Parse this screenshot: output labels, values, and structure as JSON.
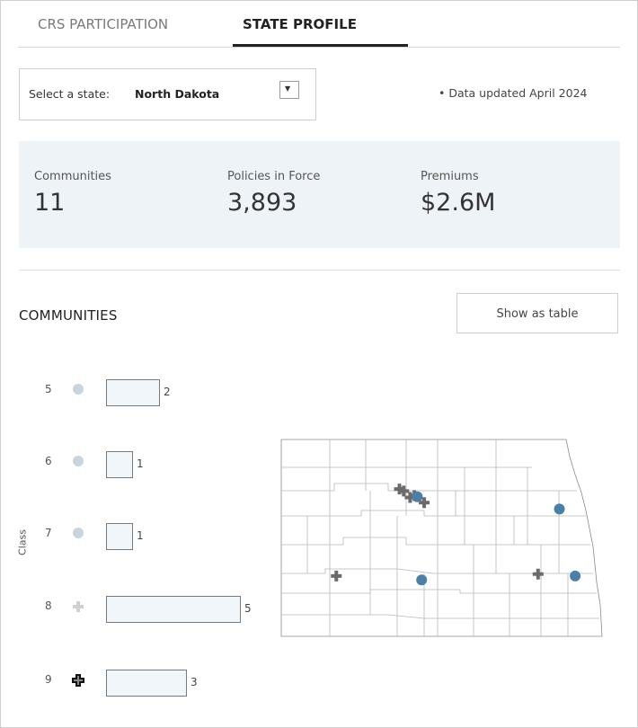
{
  "tabs": [
    {
      "label": "CRS PARTICIPATION",
      "active": false
    },
    {
      "label": "STATE PROFILE",
      "active": true
    }
  ],
  "selector": {
    "label": "Select a state:",
    "value": "North Dakota"
  },
  "updated_note": "Data updated April 2024",
  "stats": {
    "communities": {
      "label": "Communities",
      "value": "11"
    },
    "policies": {
      "label": "Policies in Force",
      "value": "3,893"
    },
    "premiums": {
      "label": "Premiums",
      "value": "$2.6M"
    }
  },
  "communities_section": {
    "title": "COMMUNITIES",
    "show_table_label": "Show as table",
    "axis_label": "Class"
  },
  "chart_data": {
    "type": "bar",
    "categories": [
      "5",
      "6",
      "7",
      "8",
      "9"
    ],
    "values": [
      2,
      1,
      1,
      5,
      3
    ],
    "ylabel": "Class",
    "xlabel": ""
  },
  "colors": {
    "dot_inactive": "#c9d4de",
    "community_dot": "#4a7fa8",
    "community_plus": "#6b6b6b",
    "bar_fill": "#f1f6fb",
    "stats_bg": "#eef3f7"
  },
  "map": {
    "state": "North Dakota",
    "markers": [
      {
        "type": "plus",
        "lon": -101.3,
        "lat": 48.23
      },
      {
        "type": "plus",
        "lon": -101.2,
        "lat": 48.2
      },
      {
        "type": "plus",
        "lon": -101.05,
        "lat": 48.1
      },
      {
        "type": "plus",
        "lon": -100.95,
        "lat": 48.13
      },
      {
        "type": "plus",
        "lon": -100.72,
        "lat": 48.02
      },
      {
        "type": "circle",
        "lon": -100.88,
        "lat": 48.11
      },
      {
        "type": "circle",
        "lon": -97.55,
        "lat": 47.92
      },
      {
        "type": "circle",
        "lon": -97.18,
        "lat": 46.88
      },
      {
        "type": "circle",
        "lon": -100.78,
        "lat": 46.82
      },
      {
        "type": "plus",
        "lon": -102.78,
        "lat": 46.88
      },
      {
        "type": "plus",
        "lon": -98.05,
        "lat": 46.91
      }
    ]
  }
}
